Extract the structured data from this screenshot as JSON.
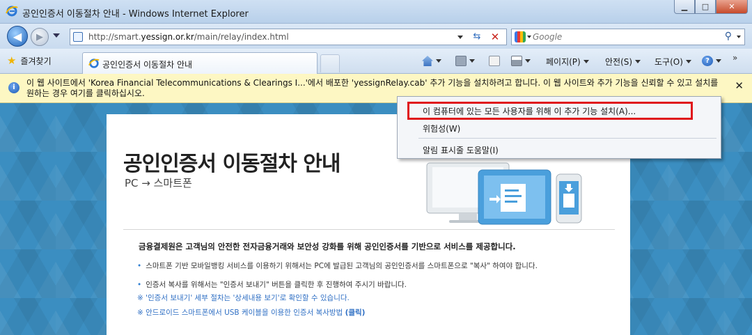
{
  "window": {
    "title": "공인인증서 이동절차 안내 - Windows Internet Explorer",
    "controls": {
      "minimize": "▁",
      "maximize": "□",
      "close": "✕"
    }
  },
  "address": {
    "url_prefix": "http://smart.",
    "url_domain": "yessign.or.kr",
    "url_path": "/main/relay/index.html"
  },
  "search": {
    "placeholder": "Google"
  },
  "toolbar": {
    "favorites_label": "즐겨찾기",
    "tab_label": "공인인증서 이동절차 안내",
    "page_menu": "페이지(P)",
    "safety_menu": "안전(S)",
    "tools_menu": "도구(O)"
  },
  "infobar": {
    "text": "이 웹 사이트에서 'Korea Financial Telecommunications & Clearings I...'에서 배포한 'yessignRelay.cab' 추가 기능을 설치하려고 합니다. 이 웹 사이트와 추가 기능을 신뢰할 수 있고 설치를 원하는 경우 여기를 클릭하십시오."
  },
  "context_menu": {
    "items": [
      "이 컴퓨터에 있는 모든 사용자를 위해 이 추가 기능 설치(A)...",
      "위험성(W)",
      "알림 표시줄 도움말(I)"
    ]
  },
  "page": {
    "title": "공인인증서 이동절차 안내",
    "subtitle": "PC → 스마트폰",
    "lead": "금융결제원은 고객님의 안전한 전자금융거래와 보안성 강화를 위해 공인인증서를 기반으로 서비스를 제공합니다.",
    "bullets": [
      "스마트폰 기반 모바일뱅킹 서비스를 이용하기 위해서는 PC에 발급된 고객님의 공인인증서를 스마트폰으로 \"복사\" 하여야 합니다.",
      "인증서 복사를 위해서는 \"인증서 보내기\" 버튼을 클릭한 후 진행하여 주시기 바랍니다."
    ],
    "notes": [
      "※ '인증서 보내기' 세부 절차는 '상세내용 보기'로 확인할 수 있습니다.",
      "※ 안드로이드 스마트폰에서 USB 케이블을 이용한 인증서 복사방법",
      "(클릭)"
    ]
  },
  "colors": {
    "highlight_border": "#e0151b",
    "content_background": "#3b8ec1",
    "infobar_background": "#fdf7c3",
    "note_text": "#2f6fc4"
  }
}
